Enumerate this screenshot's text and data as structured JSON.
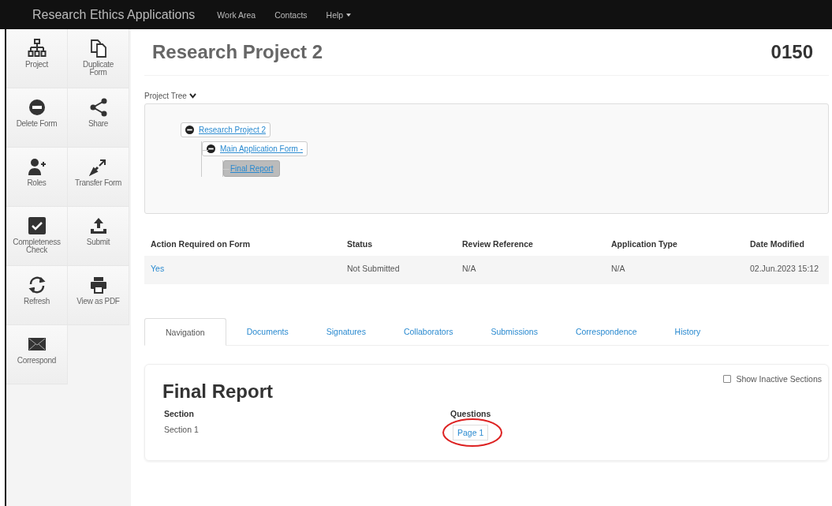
{
  "navbar": {
    "brand": "Research Ethics Applications",
    "links": [
      {
        "label": "Work Area",
        "dropdown": false
      },
      {
        "label": "Contacts",
        "dropdown": false
      },
      {
        "label": "Help",
        "dropdown": true
      }
    ]
  },
  "sidebar": {
    "actions": [
      {
        "label": "Project",
        "kind": "hierarchy"
      },
      {
        "label": "Duplicate Form",
        "kind": "copy"
      },
      {
        "label": "Delete Form",
        "kind": "delete"
      },
      {
        "label": "Share",
        "kind": "share"
      },
      {
        "label": "Roles",
        "kind": "roles"
      },
      {
        "label": "Transfer Form",
        "kind": "transfer"
      },
      {
        "label": "Completeness Check",
        "kind": "check"
      },
      {
        "label": "Submit",
        "kind": "upload"
      },
      {
        "label": "Refresh",
        "kind": "refresh"
      },
      {
        "label": "View as PDF",
        "kind": "print"
      },
      {
        "label": "Correspond",
        "kind": "envelope"
      }
    ]
  },
  "header": {
    "title": "Research Project 2",
    "number": "0150"
  },
  "project_tree": {
    "label": "Project Tree",
    "expanded": true,
    "nodes": [
      {
        "label": "Research Project 2",
        "selected": false,
        "expanded": true,
        "children": [
          {
            "label": "Main Application Form -",
            "selected": false,
            "expanded": true,
            "children": [
              {
                "label": "Final Report",
                "selected": true
              }
            ]
          }
        ]
      }
    ]
  },
  "info_table": {
    "columns": [
      "Action Required on Form",
      "Status",
      "Review Reference",
      "Application Type",
      "Date Modified"
    ],
    "rows": [
      [
        {
          "text": "Yes",
          "kind": "link"
        },
        {
          "text": "Not Submitted",
          "kind": "text"
        },
        {
          "text": "N/A",
          "kind": "text"
        },
        {
          "text": "N/A",
          "kind": "text"
        },
        {
          "text": "02.Jun.2023 15:12",
          "kind": "text"
        }
      ]
    ]
  },
  "tabs": [
    {
      "label": "Navigation",
      "selected": true
    },
    {
      "label": "Documents",
      "selected": false
    },
    {
      "label": "Signatures",
      "selected": false
    },
    {
      "label": "Collaborators",
      "selected": false
    },
    {
      "label": "Submissions",
      "selected": false
    },
    {
      "label": "Correspondence",
      "selected": false
    },
    {
      "label": "History",
      "selected": false
    }
  ],
  "panel": {
    "title": "Final Report",
    "show_inactive": {
      "label": "Show Inactive Sections",
      "checked": false
    },
    "columns": [
      "Section",
      "Questions"
    ],
    "rows": [
      {
        "section": "Section 1",
        "question": "Page 1",
        "circled": true
      }
    ]
  }
}
